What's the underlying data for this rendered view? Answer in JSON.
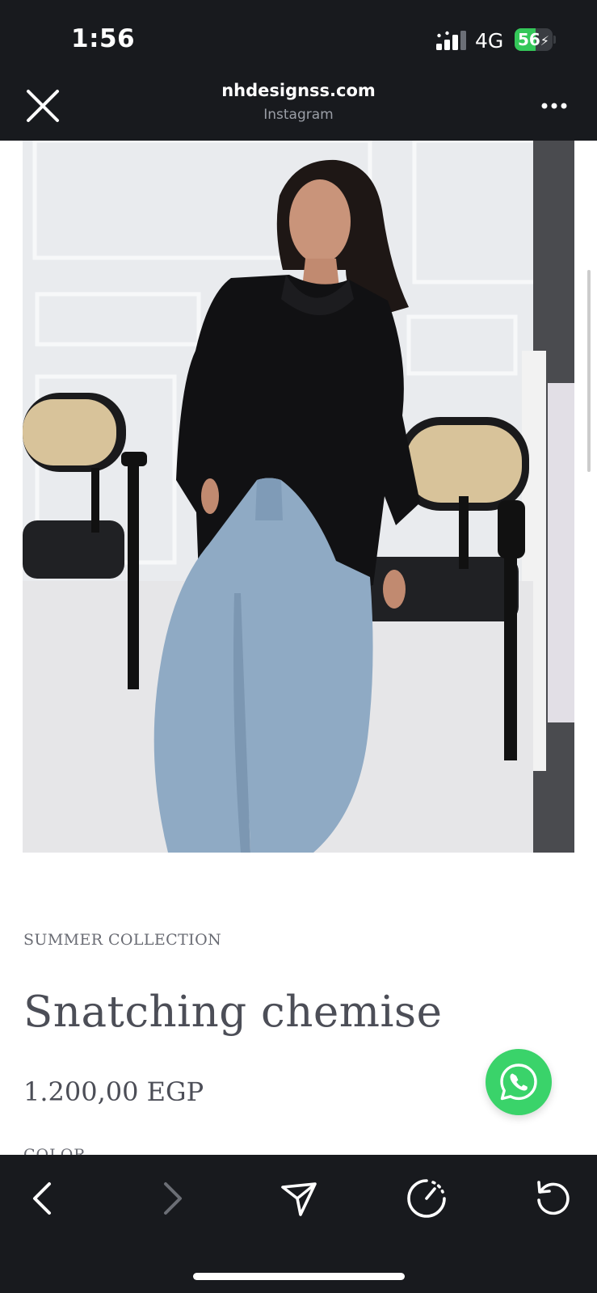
{
  "status_bar": {
    "time": "1:56",
    "network": "4G",
    "battery_percent": 56,
    "battery_label": "56"
  },
  "browser": {
    "domain": "nhdesignss.com",
    "source": "Instagram"
  },
  "product": {
    "collection": "SUMMER COLLECTION",
    "name": "Snatching chemise",
    "price": "1.200,00 EGP",
    "option_label": "COLOR"
  },
  "icons": {
    "close": "close-icon",
    "more": "more-horizontal-icon",
    "whatsapp": "whatsapp-icon",
    "back": "chevron-left-icon",
    "forward": "chevron-right-icon",
    "share": "send-icon",
    "speed": "speedometer-icon",
    "reload": "reload-icon"
  },
  "colors": {
    "chrome_background": "#181a1e",
    "whatsapp_green": "#3ad36a",
    "battery_green": "#34c759",
    "text_dark": "#4c4e57"
  }
}
